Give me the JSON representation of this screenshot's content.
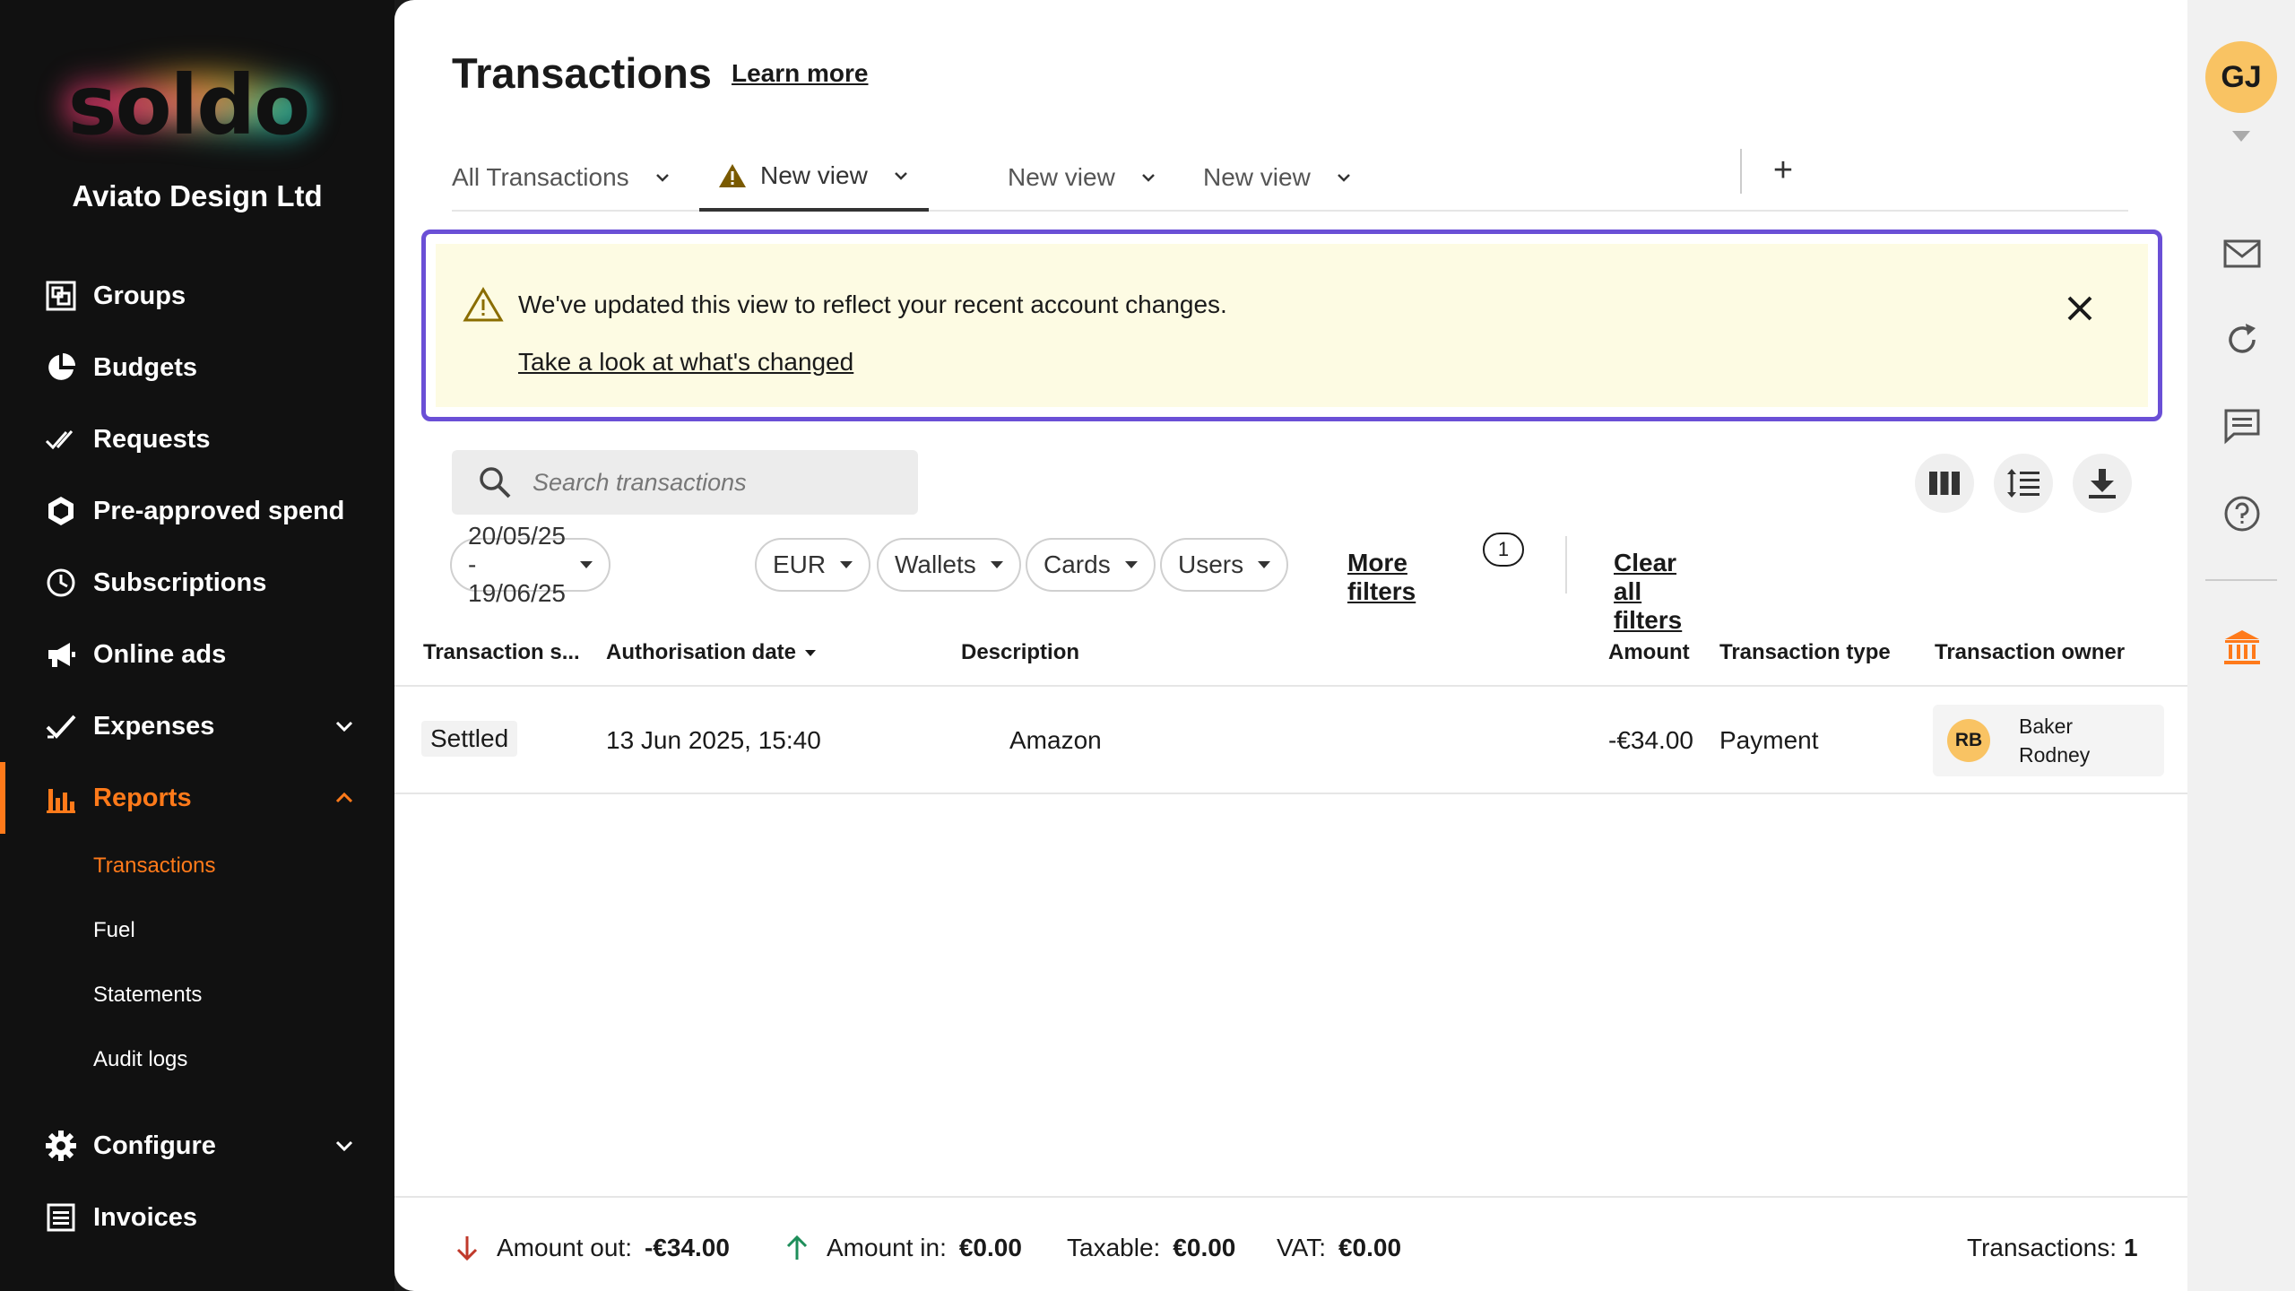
{
  "sidebar": {
    "logo_text": "soldo",
    "company": "Aviato Design Ltd",
    "items": [
      {
        "label": "Groups",
        "icon": "groups-icon"
      },
      {
        "label": "Budgets",
        "icon": "pie-chart-icon"
      },
      {
        "label": "Requests",
        "icon": "double-check-icon"
      },
      {
        "label": "Pre-approved spend",
        "icon": "hexagon-icon"
      },
      {
        "label": "Subscriptions",
        "icon": "clock-icon"
      },
      {
        "label": "Online ads",
        "icon": "megaphone-icon"
      },
      {
        "label": "Expenses",
        "icon": "check-icon"
      },
      {
        "label": "Reports",
        "icon": "bar-chart-icon"
      },
      {
        "label": "Configure",
        "icon": "gear-icon"
      },
      {
        "label": "Invoices",
        "icon": "invoice-icon"
      }
    ],
    "reports_sub": [
      "Transactions",
      "Fuel",
      "Statements",
      "Audit logs"
    ],
    "accent": "#ff7a1a"
  },
  "header": {
    "title": "Transactions",
    "learn_more": "Learn more"
  },
  "tabs": [
    {
      "label": "All Transactions"
    },
    {
      "label": "New view",
      "warning": true
    },
    {
      "label": "New view"
    },
    {
      "label": "New view"
    }
  ],
  "tab_add": "+",
  "banner": {
    "message": "We've updated this view to reflect your recent account changes.",
    "link": "Take a look at what's changed",
    "border_color": "#6a4fd6"
  },
  "search": {
    "placeholder": "Search transactions"
  },
  "filters": {
    "chips": [
      "20/05/25 - 19/06/25",
      "EUR",
      "Wallets",
      "Cards",
      "Users"
    ],
    "more_filters": "More filters",
    "more_filters_count": "1",
    "clear_all": "Clear all filters"
  },
  "table": {
    "columns": [
      "Transaction s...",
      "Authorisation date",
      "Description",
      "Amount",
      "Transaction type",
      "Transaction owner"
    ],
    "rows": [
      {
        "status": "Settled",
        "date": "13 Jun 2025, 15:40",
        "description": "Amazon",
        "amount": "-€34.00",
        "type": "Payment",
        "owner_initials": "RB",
        "owner_first": "Baker",
        "owner_last": "Rodney"
      }
    ]
  },
  "footer": {
    "amount_out_label": "Amount out:",
    "amount_out": "-€34.00",
    "amount_in_label": "Amount in:",
    "amount_in": "€0.00",
    "taxable_label": "Taxable:",
    "taxable": "€0.00",
    "vat_label": "VAT:",
    "vat": "€0.00",
    "transactions_label": "Transactions:",
    "transactions": "1"
  },
  "rail": {
    "user_initials": "GJ",
    "icons": [
      "mail-icon",
      "refresh-icon",
      "chat-icon",
      "help-icon",
      "bank-icon"
    ]
  }
}
